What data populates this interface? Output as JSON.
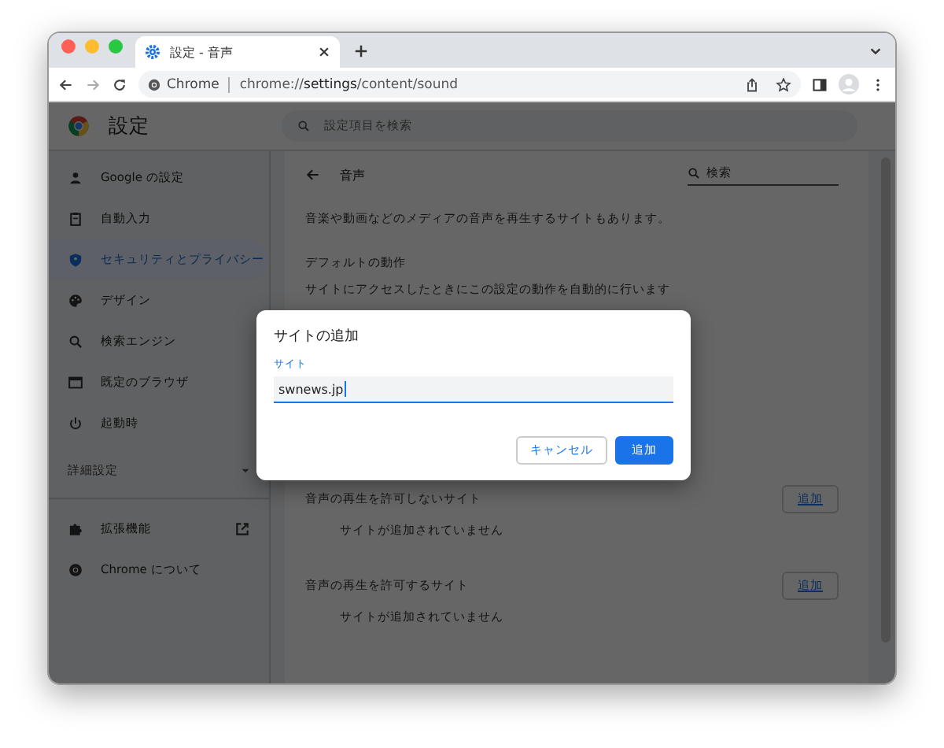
{
  "browser": {
    "tab_title": "設定 - 音声",
    "omnibox_chip": "Chrome",
    "url_host": "chrome://",
    "url_bold": "settings",
    "url_path": "/content/sound"
  },
  "header": {
    "title": "設定",
    "search_placeholder": "設定項目を検索"
  },
  "sidebar": {
    "items": [
      {
        "label": "Google の設定",
        "kind": "person",
        "selected": false
      },
      {
        "label": "自動入力",
        "kind": "clipboard",
        "selected": false
      },
      {
        "label": "セキュリティとプライバシー",
        "kind": "shield",
        "selected": true
      },
      {
        "label": "デザイン",
        "kind": "palette",
        "selected": false
      },
      {
        "label": "検索エンジン",
        "kind": "search",
        "selected": false
      },
      {
        "label": "既定のブラウザ",
        "kind": "browser",
        "selected": false
      },
      {
        "label": "起動時",
        "kind": "power",
        "selected": false
      }
    ],
    "advanced": "詳細設定",
    "bottom_items": [
      {
        "label": "拡張機能",
        "kind": "extensions"
      },
      {
        "label": "Chrome について",
        "kind": "about"
      }
    ]
  },
  "main": {
    "title": "音声",
    "search_placeholder": "検索",
    "description": "音楽や動画などのメディアの音声を再生するサイトもあります。",
    "default_heading": "デフォルトの動作",
    "default_note": "サイトにアクセスしたときにこの設定の動作を自動的に行います",
    "lists": [
      {
        "title": "音声の再生を許可しないサイト",
        "add": "追加",
        "empty": "サイトが追加されていません"
      },
      {
        "title": "音声の再生を許可するサイト",
        "add": "追加",
        "empty": "サイトが追加されていません"
      }
    ]
  },
  "dialog": {
    "title": "サイトの追加",
    "field_label": "サイト",
    "field_value": "swnews.jp",
    "buttons": [
      {
        "label": "キャンセル",
        "kind": "secondary"
      },
      {
        "label": "追加",
        "kind": "primary"
      }
    ]
  }
}
